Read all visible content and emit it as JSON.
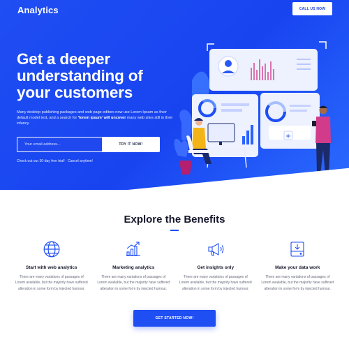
{
  "header": {
    "brand": "Analytics",
    "cta_label": "CALL US NOW"
  },
  "hero": {
    "headline": "Get a deeper understanding of your customers",
    "lead_part1": "Many desktop publishing packages and web page editors now use Lorem Ipsum as their default model text, and a search for ",
    "lead_bold": "'lorem ipsum' will uncover",
    "lead_part2": " many web sites still in their infancy.",
    "email_placeholder": "Your email address...",
    "submit_label": "TRY IT NOW!",
    "trial_note": "Check out our 30-day free trial!  ·  Cancel anytime!"
  },
  "benefits": {
    "title": "Explore the Benefits",
    "items": [
      {
        "icon": "globe-icon",
        "title": "Start with web analytics",
        "text": "There are many variations of passages of Lorem available, but the majority have suffered alteration in some form by injected humour."
      },
      {
        "icon": "growth-chart-icon",
        "title": "Marketing analytics",
        "text": "There are many variations of passages of Lorem available, but the majority have suffered alteration in some form by injected humour."
      },
      {
        "icon": "megaphone-icon",
        "title": "Get insights only",
        "text": "There are many variations of passages of Lorem available, but the majority have suffered alteration in some form by injected humour."
      },
      {
        "icon": "data-box-icon",
        "title": "Make your data work",
        "text": "There are many variations of passages of Lorem available, but the majority have suffered alteration in some form by injected humour."
      }
    ],
    "cta_label": "GET STARTED NOW!"
  },
  "colors": {
    "primary": "#1f4ef3",
    "accent_pink": "#d23b8a",
    "text_dark": "#15162b"
  }
}
